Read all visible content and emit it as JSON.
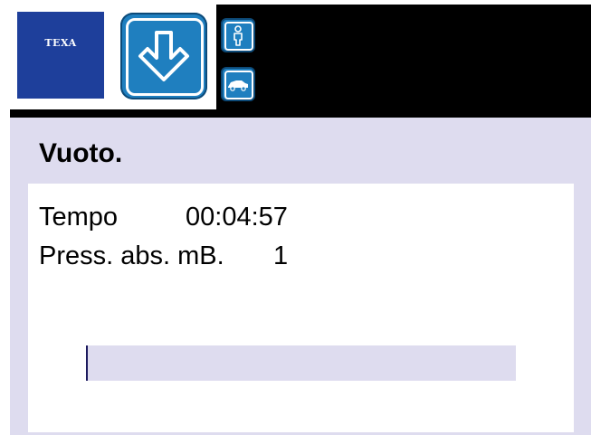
{
  "header": {
    "logo_text": "TEXA",
    "mode_icon": "download-arrow-icon",
    "side_icons": [
      "person-icon",
      "car-icon"
    ]
  },
  "main": {
    "title": "Vuoto.",
    "time_label": "Tempo",
    "time_value": "00:04:57",
    "pressure_label": "Press. abs. mB.",
    "pressure_value": "1",
    "progress_fraction": 0.005
  },
  "colors": {
    "logo_blue": "#1e3f9b",
    "icon_blue": "#1f7fbf",
    "background_lavender": "#dedcef",
    "progress_fill": "#1c1a5e"
  }
}
